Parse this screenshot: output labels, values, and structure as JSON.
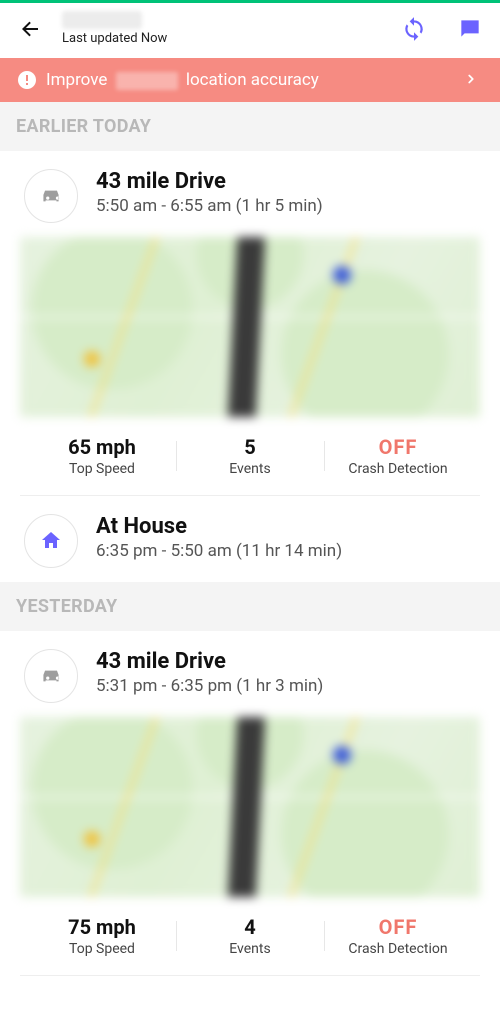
{
  "header": {
    "last_updated": "Last updated Now"
  },
  "banner": {
    "prefix": "Improve",
    "suffix": "location accuracy"
  },
  "sections": {
    "earlier_today": "EARLIER TODAY",
    "yesterday": "YESTERDAY"
  },
  "entries": {
    "drive1": {
      "title": "43 mile Drive",
      "time": "5:50 am - 6:55 am (1 hr 5 min)",
      "stats": {
        "top_speed_val": "65 mph",
        "top_speed_label": "Top Speed",
        "events_val": "5",
        "events_label": "Events",
        "crash_val": "OFF",
        "crash_label": "Crash Detection"
      }
    },
    "home1": {
      "title": "At House",
      "time": "6:35 pm - 5:50 am (11 hr 14 min)"
    },
    "drive2": {
      "title": "43 mile Drive",
      "time": "5:31 pm - 6:35 pm (1 hr 3 min)",
      "stats": {
        "top_speed_val": "75 mph",
        "top_speed_label": "Top Speed",
        "events_val": "4",
        "events_label": "Events",
        "crash_val": "OFF",
        "crash_label": "Crash Detection"
      }
    }
  },
  "colors": {
    "accent_purple": "#6b63ff",
    "banner": "#f68b82",
    "off_text": "#f0776c"
  }
}
